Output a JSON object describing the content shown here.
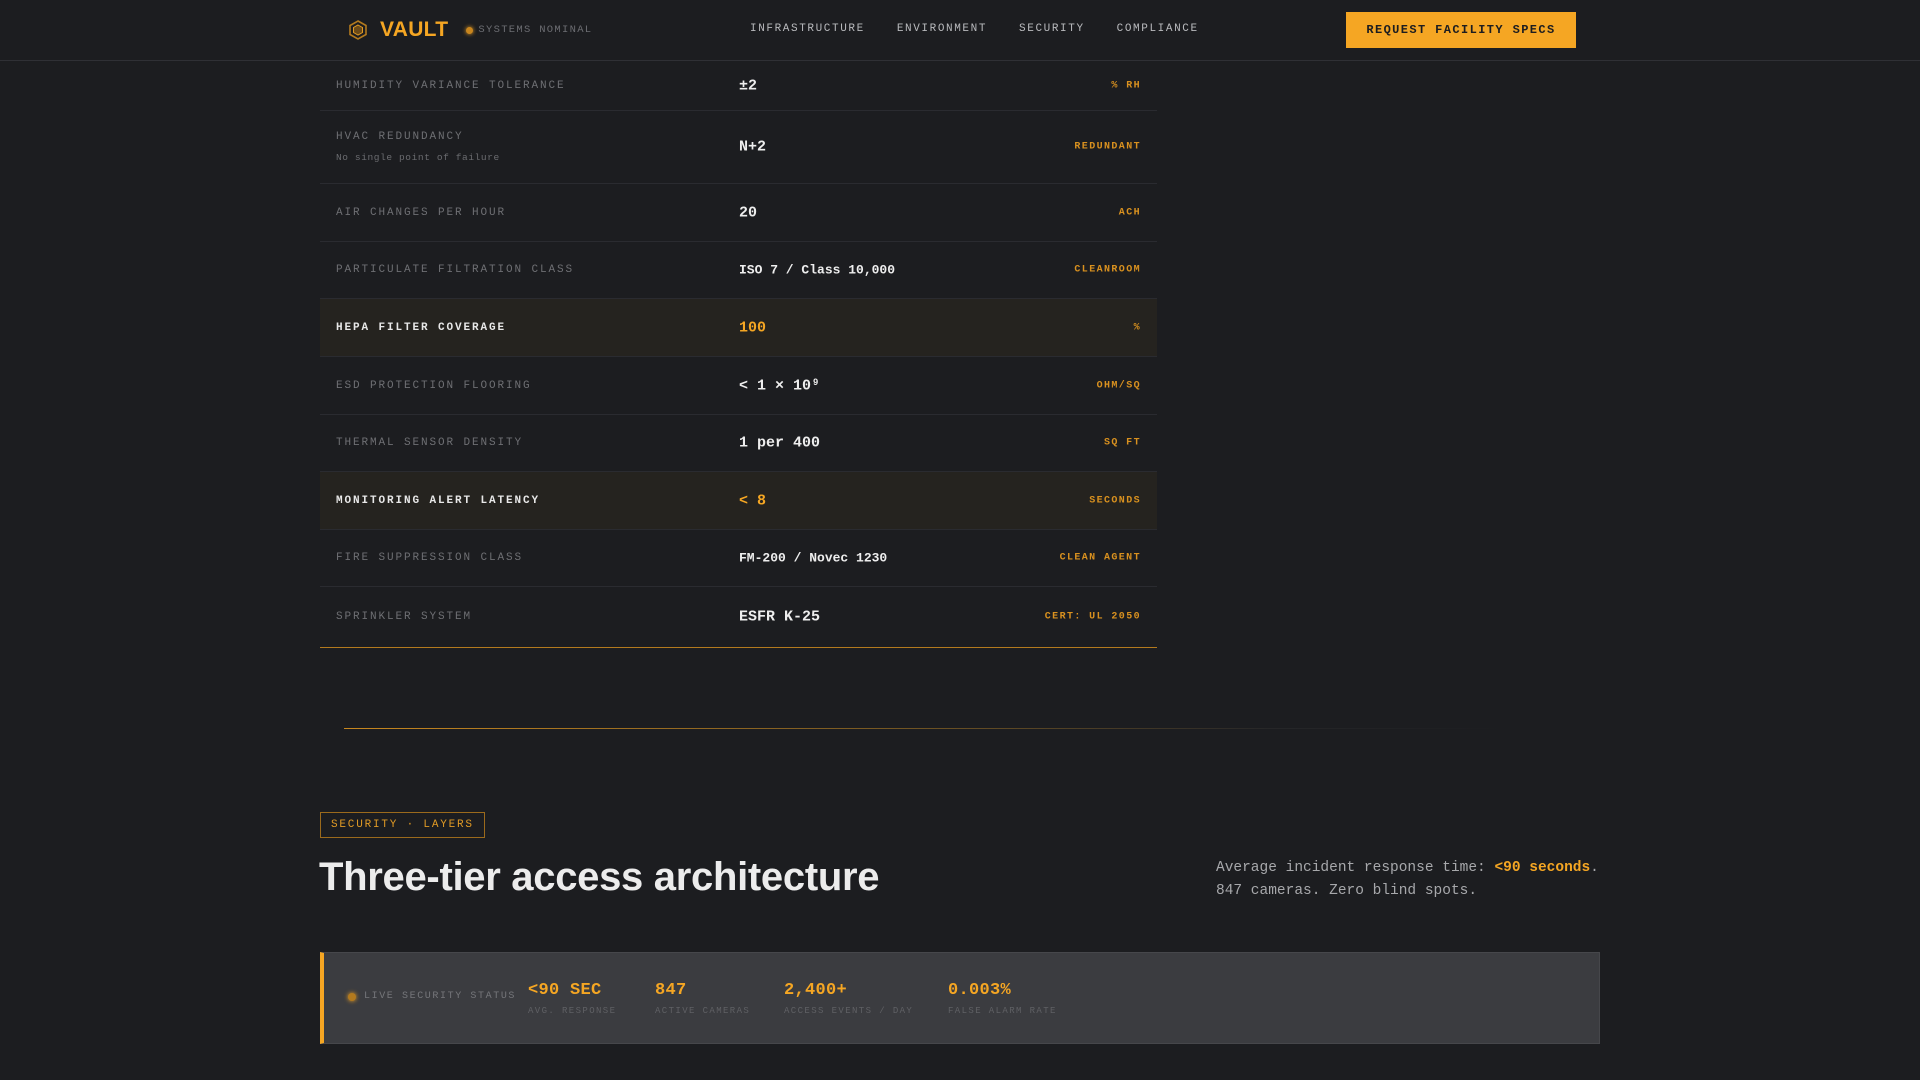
{
  "header": {
    "brand": "VAULT",
    "status": "SYSTEMS NOMINAL",
    "nav": [
      "INFRASTRUCTURE",
      "ENVIRONMENT",
      "SECURITY",
      "COMPLIANCE"
    ],
    "cta": "REQUEST FACILITY SPECS"
  },
  "specs": [
    {
      "label": "HUMIDITY VARIANCE TOLERANCE",
      "value": "±2",
      "unit": "% RH"
    },
    {
      "label": "HVAC REDUNDANCY",
      "sub": "No single point of failure",
      "value": "N+2",
      "unit": "REDUNDANT"
    },
    {
      "label": "AIR CHANGES PER HOUR",
      "value": "20",
      "unit": "ACH"
    },
    {
      "label": "PARTICULATE FILTRATION CLASS",
      "value": "ISO 7 / Class 10,000",
      "unit": "CLEANROOM"
    },
    {
      "label": "HEPA FILTER COVERAGE",
      "value": "100",
      "unit": "%"
    },
    {
      "label": "ESD PROTECTION FLOORING",
      "value": "< 1 × 10⁹",
      "unit": "OHM/SQ"
    },
    {
      "label": "THERMAL SENSOR DENSITY",
      "value": "1 per 400",
      "unit": "SQ FT"
    },
    {
      "label": "MONITORING ALERT LATENCY",
      "value": "< 8",
      "unit": "SECONDS"
    },
    {
      "label": "FIRE SUPPRESSION CLASS",
      "value": "FM-200 / Novec 1230",
      "unit": "CLEAN AGENT"
    },
    {
      "label": "SPRINKLER SYSTEM",
      "value": "ESFR K-25",
      "unit": "CERT: UL 2050"
    }
  ],
  "security": {
    "tag": "SECURITY · LAYERS",
    "headline": "Three-tier access architecture",
    "blurb_prefix": "Average incident response time: ",
    "blurb_accent": "<90 seconds",
    "blurb_suffix": ".",
    "blurb_line2": "847 cameras. Zero blind spots."
  },
  "live_status": {
    "label": "LIVE SECURITY STATUS",
    "metrics": [
      {
        "value": "<90 SEC",
        "label": "AVG. RESPONSE"
      },
      {
        "value": "847",
        "label": "ACTIVE CAMERAS"
      },
      {
        "value": "2,400+",
        "label": "ACCESS EVENTS / DAY"
      },
      {
        "value": "0.003%",
        "label": "FALSE ALARM RATE"
      }
    ]
  },
  "colors": {
    "accent": "#f5a623",
    "background": "#1c1d20",
    "status_bar": "#3b3c40"
  }
}
